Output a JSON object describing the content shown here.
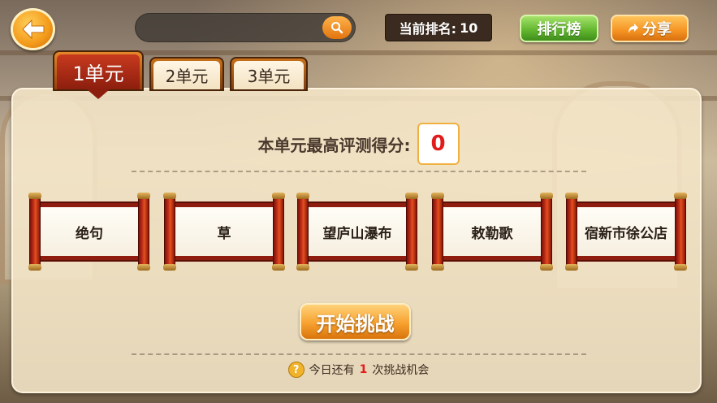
{
  "header": {
    "rank_label": "当前排名:",
    "rank_value": "10",
    "leaderboard_label": "排行榜",
    "share_label": "分享"
  },
  "tabs": [
    {
      "label": "1单元",
      "active": true
    },
    {
      "label": "2单元",
      "active": false
    },
    {
      "label": "3单元",
      "active": false
    }
  ],
  "score": {
    "label": "本单元最高评测得分:",
    "value": "0"
  },
  "poems": [
    {
      "title": "绝句"
    },
    {
      "title": "草"
    },
    {
      "title": "望庐山瀑布"
    },
    {
      "title": "敕勒歌"
    },
    {
      "title": "宿新市徐公店"
    }
  ],
  "start_label": "开始挑战",
  "hint": {
    "prefix": "今日还有",
    "count": "1",
    "suffix": "次挑战机会"
  },
  "colors": {
    "accent_orange": "#f59323",
    "leaderboard_green": "#5fb42c",
    "score_red": "#e21b1b",
    "active_tab_red": "#c83a1e"
  },
  "icons": {
    "back": "arrow-left-icon",
    "search": "search-icon",
    "share": "share-arrow-icon",
    "help": "question-icon"
  }
}
